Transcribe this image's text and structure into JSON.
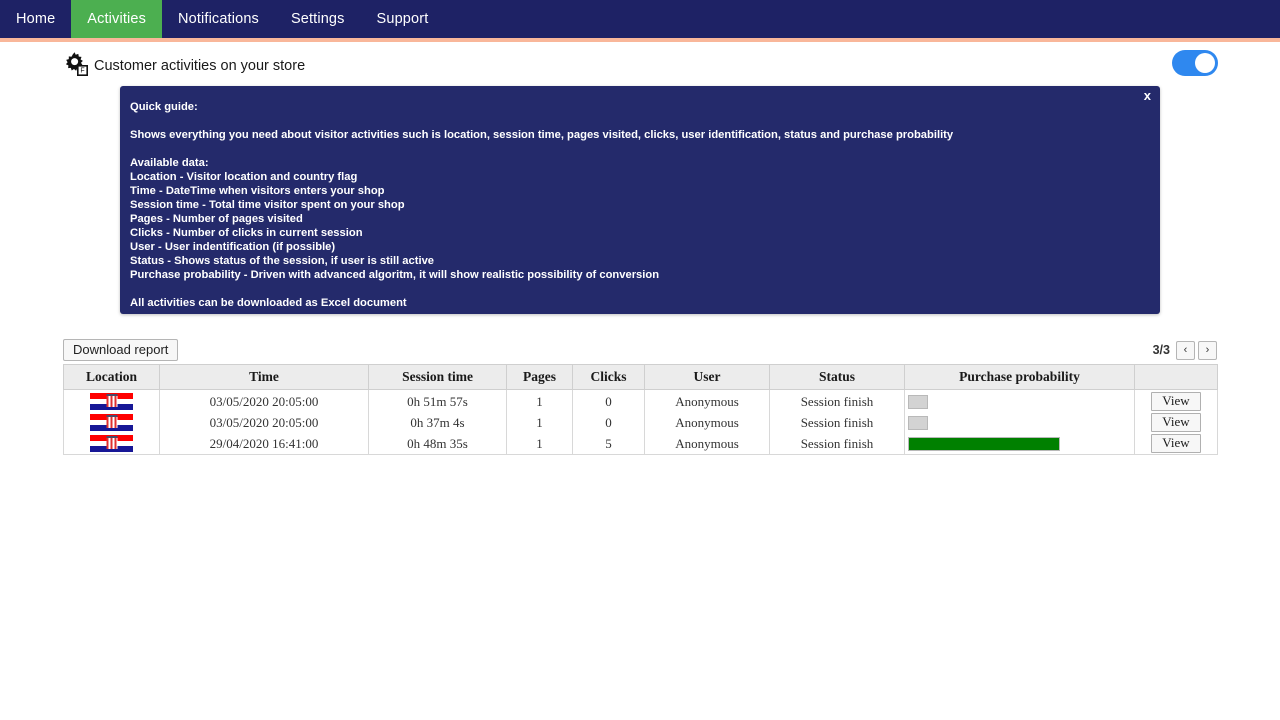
{
  "navbar": {
    "items": [
      {
        "label": "Home",
        "active": false
      },
      {
        "label": "Activities",
        "active": true
      },
      {
        "label": "Notifications",
        "active": false
      },
      {
        "label": "Settings",
        "active": false
      },
      {
        "label": "Support",
        "active": false
      }
    ],
    "background_color": "#1e2265",
    "active_color": "#4caf50",
    "divider_color": "#f9b79a"
  },
  "header": {
    "icon": "gear-settings-icon",
    "title": "Customer activities on your store",
    "toggle": {
      "state": "on",
      "color": "#2f88ef"
    }
  },
  "guide": {
    "close_label": "x",
    "title": "Quick guide:",
    "intro": "Shows everything you need about visitor activities such is location, session time, pages visited, clicks, user identification, status and purchase probability",
    "available_heading": "Available data:",
    "items": [
      "Location - Visitor location and country flag",
      "Time - DateTime when visitors enters your shop",
      "Session time - Total time visitor spent on your shop",
      "Pages - Number of pages visited",
      "Clicks - Number of clicks in current session",
      "User - User indentification (if possible)",
      "Status - Shows status of the session, if user is still active",
      "Purchase probability - Driven with advanced algoritm, it will show realistic possibility of conversion"
    ],
    "footer": "All activities can be downloaded as Excel document",
    "background_color": "#242a6b"
  },
  "toolbar": {
    "download_label": "Download report",
    "page_indicator": "3/3",
    "prev_label": "‹",
    "next_label": "›"
  },
  "table": {
    "columns": [
      "Location",
      "Time",
      "Session time",
      "Pages",
      "Clicks",
      "User",
      "Status",
      "Purchase probability",
      ""
    ],
    "rows": [
      {
        "flag": "croatia-flag",
        "time": "03/05/2020 20:05:00",
        "session_time": "0h 51m 57s",
        "pages": "1",
        "clicks": "0",
        "user": "Anonymous",
        "status": "Session finish",
        "probability_percent": 9,
        "probability_color": "#d3d3d3",
        "action_label": "View"
      },
      {
        "flag": "croatia-flag",
        "time": "03/05/2020 20:05:00",
        "session_time": "0h 37m 4s",
        "pages": "1",
        "clicks": "0",
        "user": "Anonymous",
        "status": "Session finish",
        "probability_percent": 9,
        "probability_color": "#d3d3d3",
        "action_label": "View"
      },
      {
        "flag": "croatia-flag",
        "time": "29/04/2020 16:41:00",
        "session_time": "0h 48m 35s",
        "pages": "1",
        "clicks": "5",
        "user": "Anonymous",
        "status": "Session finish",
        "probability_percent": 68,
        "probability_color": "#008000",
        "action_label": "View"
      }
    ]
  }
}
